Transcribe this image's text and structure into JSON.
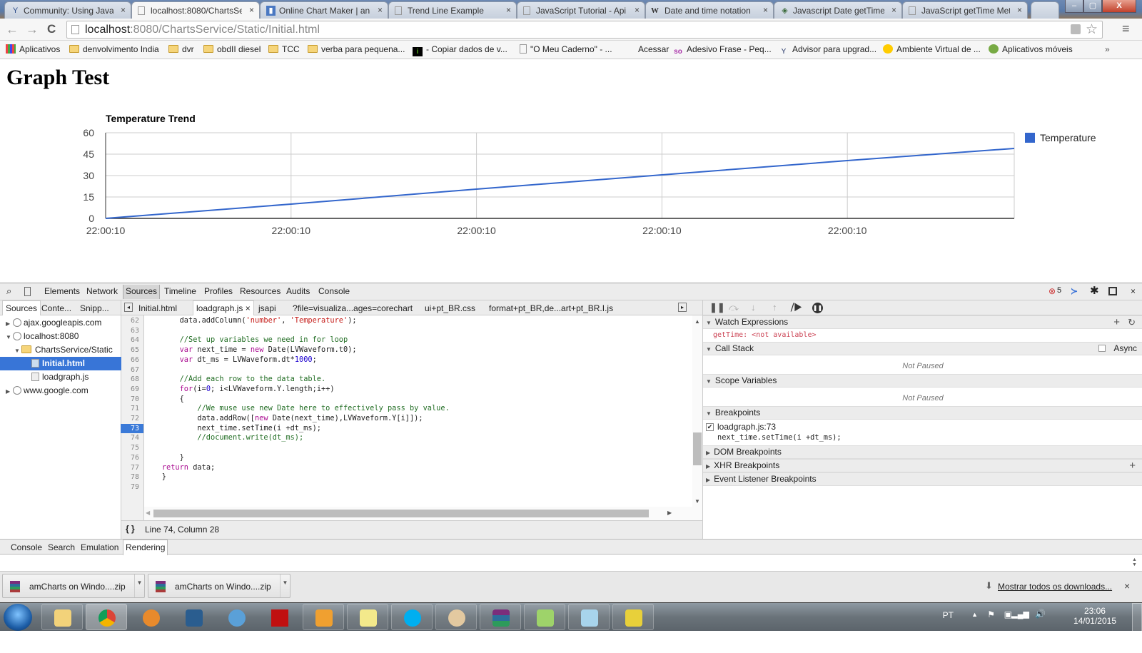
{
  "browser": {
    "tabs": [
      {
        "title": "Community: Using Java",
        "icon": "community-icon"
      },
      {
        "title": "localhost:8080/ChartsSe",
        "icon": "page-icon",
        "active": true
      },
      {
        "title": "Online Chart Maker | an",
        "icon": "chart-maker-icon"
      },
      {
        "title": "Trend Line Example",
        "icon": "page-icon"
      },
      {
        "title": "JavaScript Tutorial - Api",
        "icon": "page-icon"
      },
      {
        "title": "Date and time notation",
        "icon": "wikipedia-icon"
      },
      {
        "title": "Javascript Date getTime",
        "icon": "site-icon"
      },
      {
        "title": "JavaScript getTime Met",
        "icon": "page-icon"
      }
    ],
    "tab_close": "×",
    "window_controls": {
      "minimize": "–",
      "maximize": "▢",
      "close": "X"
    },
    "url_host": "localhost",
    "url_rest": ":8080/ChartsService/Static/Initial.html",
    "nav": {
      "back": "←",
      "forward": "→",
      "reload": "C"
    },
    "bookmarks": [
      {
        "label": "Aplicativos",
        "icon": "apps-icon"
      },
      {
        "label": "denvolvimento India",
        "icon": "folder-icon"
      },
      {
        "label": "dvr",
        "icon": "folder-icon"
      },
      {
        "label": "obdII diesel",
        "icon": "folder-icon"
      },
      {
        "label": "TCC",
        "icon": "folder-icon"
      },
      {
        "label": "verba para pequena...",
        "icon": "folder-icon"
      },
      {
        "label": "- Copiar dados de v...",
        "icon": "info-icon"
      },
      {
        "label": "\"O Meu Caderno\" - ...",
        "icon": "page-icon"
      },
      {
        "label": "Acessar",
        "icon": ""
      },
      {
        "label": "Adesivo Frase - Peq...",
        "icon": "so-icon"
      },
      {
        "label": "Advisor para upgrad...",
        "icon": "advisor-icon"
      },
      {
        "label": "Ambiente Virtual de ...",
        "icon": "ava-icon"
      },
      {
        "label": "Aplicativos móveis",
        "icon": "mobile-apps-icon"
      }
    ],
    "bookmarks_more": "»"
  },
  "page": {
    "title": "Graph Test"
  },
  "chart_data": {
    "type": "line",
    "title": "Temperature Trend",
    "xlabel": "",
    "ylabel": "",
    "x_tick_labels": [
      "22:00:10",
      "22:00:10",
      "22:00:10",
      "22:00:10",
      "22:00:10"
    ],
    "x_tick_positions": [
      0,
      1,
      2,
      3,
      4
    ],
    "x_range": [
      0,
      4.9
    ],
    "y_ticks": [
      0,
      15,
      30,
      45,
      60
    ],
    "ylim": [
      0,
      60
    ],
    "grid": true,
    "legend": "right",
    "series": [
      {
        "name": "Temperature",
        "color": "#3366cc",
        "x": [
          0,
          1,
          2,
          3,
          4,
          4.9
        ],
        "values": [
          0,
          10,
          20.5,
          30.5,
          40.5,
          49
        ]
      }
    ]
  },
  "devtools": {
    "panels": [
      "Elements",
      "Network",
      "Sources",
      "Timeline",
      "Profiles",
      "Resources",
      "Audits",
      "Console"
    ],
    "active_panel": "Sources",
    "error_count": "5",
    "navigator_tabs": [
      "Sources",
      "Conte...",
      "Snipp..."
    ],
    "tree": [
      {
        "label": "ajax.googleapis.com",
        "type": "domain",
        "expanded": false
      },
      {
        "label": "localhost:8080",
        "type": "domain",
        "expanded": true
      },
      {
        "label": "ChartsService/Static",
        "type": "folder",
        "expanded": true
      },
      {
        "label": "Initial.html",
        "type": "file",
        "selected": true
      },
      {
        "label": "loadgraph.js",
        "type": "file"
      },
      {
        "label": "www.google.com",
        "type": "domain",
        "expanded": false
      }
    ],
    "editor_tabs": [
      {
        "label": "Initial.html"
      },
      {
        "label": "loadgraph.js ×",
        "active": true
      },
      {
        "label": "jsapi"
      },
      {
        "label": "?file=visualiza...ages=corechart"
      },
      {
        "label": "ui+pt_BR.css"
      },
      {
        "label": "format+pt_BR,de...art+pt_BR.I.js"
      }
    ],
    "line_numbers": [
      "62",
      "63",
      "64",
      "65",
      "66",
      "67",
      "68",
      "69",
      "70",
      "71",
      "72",
      "73",
      "74",
      "75",
      "76",
      "77",
      "78",
      "79"
    ],
    "breakpoint_line": "73",
    "status": "Line 74, Column 28",
    "pretty_print": "{ }",
    "sidebar": {
      "watch_title": "Watch Expressions",
      "watch_expr": "getTime: <not available>",
      "callstack_title": "Call Stack",
      "async_label": "Async",
      "not_paused": "Not Paused",
      "scope_title": "Scope Variables",
      "breakpoints_title": "Breakpoints",
      "bp_location": "loadgraph.js:73",
      "bp_code": "next_time.setTime(i +dt_ms);",
      "dom_bp": "DOM Breakpoints",
      "xhr_bp": "XHR Breakpoints",
      "event_bp": "Event Listener Breakpoints"
    },
    "drawer_tabs": [
      "Console",
      "Search",
      "Emulation",
      "Rendering"
    ],
    "active_drawer": "Rendering"
  },
  "downloads": {
    "items": [
      "amCharts on Windo....zip",
      "amCharts on Windo....zip"
    ],
    "show_all": "Mostrar todos os downloads...",
    "close": "×"
  },
  "taskbar": {
    "language": "PT",
    "time": "23:06",
    "date": "14/01/2015"
  }
}
